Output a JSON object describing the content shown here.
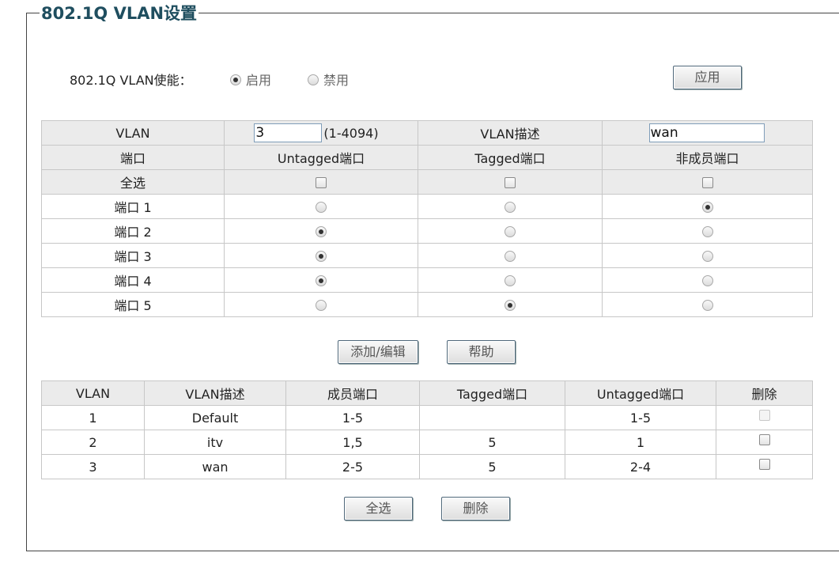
{
  "title": "802.1Q VLAN设置",
  "enable": {
    "label": "802.1Q VLAN使能：",
    "on_label": "启用",
    "off_label": "禁用",
    "selected": "on"
  },
  "apply_button": "应用",
  "config": {
    "vlan_label": "VLAN",
    "vlan_id_value": "3",
    "vlan_id_range": "(1-4094)",
    "desc_label": "VLAN描述",
    "desc_value": "wan",
    "headers": [
      "端口",
      "Untagged端口",
      "Tagged端口",
      "非成员端口"
    ],
    "select_all_label": "全选",
    "ports": [
      {
        "label": "端口 1",
        "mode": "nonmember"
      },
      {
        "label": "端口 2",
        "mode": "untagged"
      },
      {
        "label": "端口 3",
        "mode": "untagged"
      },
      {
        "label": "端口 4",
        "mode": "untagged"
      },
      {
        "label": "端口 5",
        "mode": "tagged"
      }
    ]
  },
  "add_edit_button": "添加/编辑",
  "help_button": "帮助",
  "list": {
    "headers": [
      "VLAN",
      "VLAN描述",
      "成员端口",
      "Tagged端口",
      "Untagged端口",
      "删除"
    ],
    "rows": [
      {
        "vlan": "1",
        "desc": "Default",
        "members": "1-5",
        "tagged": "",
        "untagged": "1-5",
        "deletable": false
      },
      {
        "vlan": "2",
        "desc": "itv",
        "members": "1,5",
        "tagged": "5",
        "untagged": "1",
        "deletable": true
      },
      {
        "vlan": "3",
        "desc": "wan",
        "members": "2-5",
        "tagged": "5",
        "untagged": "2-4",
        "deletable": true
      }
    ]
  },
  "select_all_button": "全选",
  "delete_button": "删除"
}
